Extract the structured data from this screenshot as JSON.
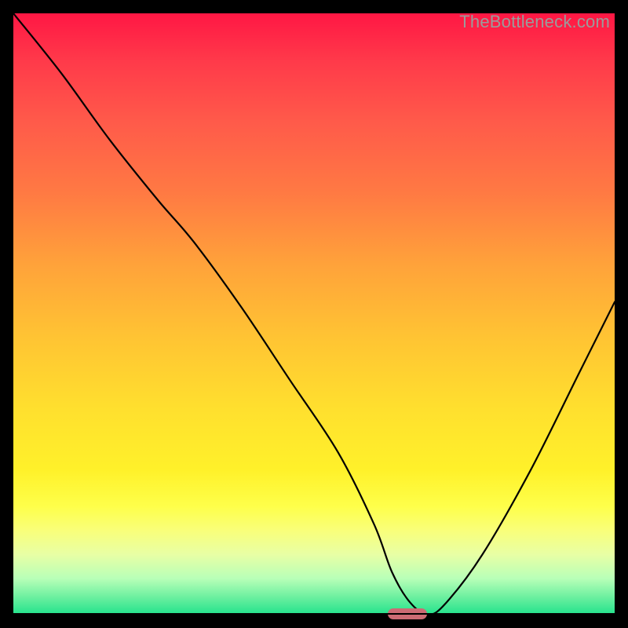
{
  "watermark": "TheBottleneck.com",
  "marker": {
    "x_frac": 0.655,
    "width_frac": 0.065,
    "color": "#cc6b74"
  },
  "chart_data": {
    "type": "line",
    "title": "",
    "xlabel": "",
    "ylabel": "",
    "xlim": [
      0,
      100
    ],
    "ylim": [
      0,
      100
    ],
    "grid": false,
    "series": [
      {
        "name": "bottleneck-curve",
        "x": [
          0,
          8,
          16,
          24,
          30,
          38,
          46,
          54,
          60,
          63,
          66,
          69,
          72,
          78,
          86,
          94,
          100
        ],
        "y": [
          100,
          90,
          79,
          69,
          62,
          51,
          39,
          27,
          15,
          7,
          2,
          0,
          2,
          10,
          24,
          40,
          52
        ]
      }
    ],
    "annotations": []
  }
}
